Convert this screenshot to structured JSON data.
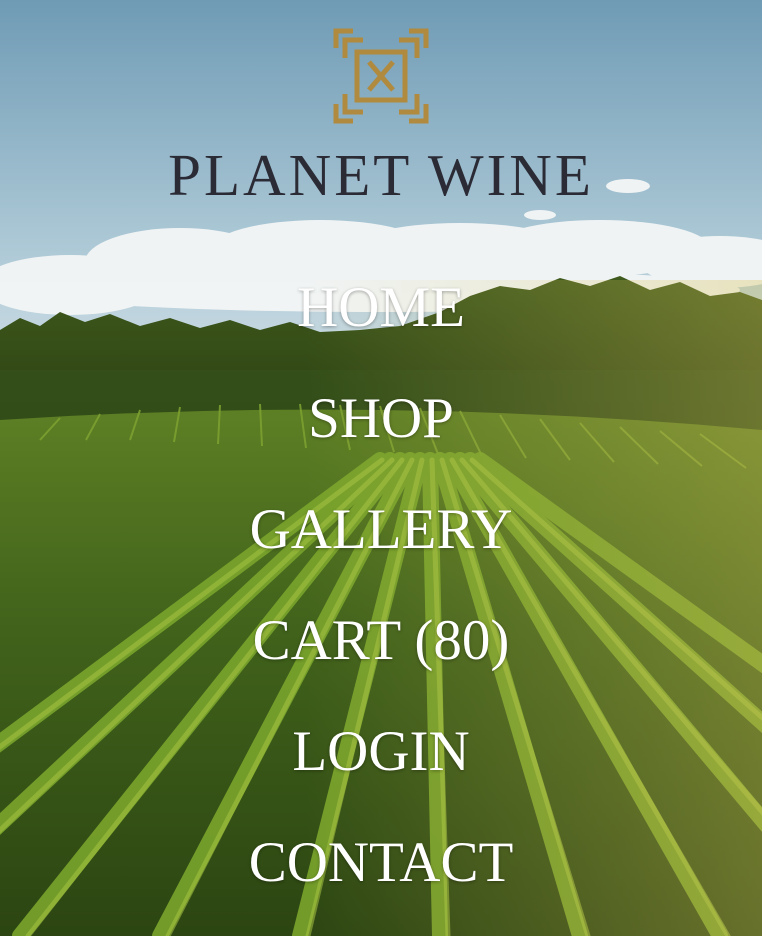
{
  "brand": {
    "name": "PLANET WINE",
    "logo_icon": "planet-wine-logo-mark",
    "logo_color": "#b08a3e",
    "name_color": "#2b2b36"
  },
  "nav": {
    "items": [
      {
        "label": "HOME"
      },
      {
        "label": "SHOP"
      },
      {
        "label": "GALLERY"
      },
      {
        "label": "CART (80)"
      },
      {
        "label": "LOGIN"
      },
      {
        "label": "CONTACT"
      }
    ],
    "text_color": "#ffffff"
  },
  "background": {
    "sky_color": "#7fa7bc",
    "foliage_color": "#3f6b1d"
  }
}
